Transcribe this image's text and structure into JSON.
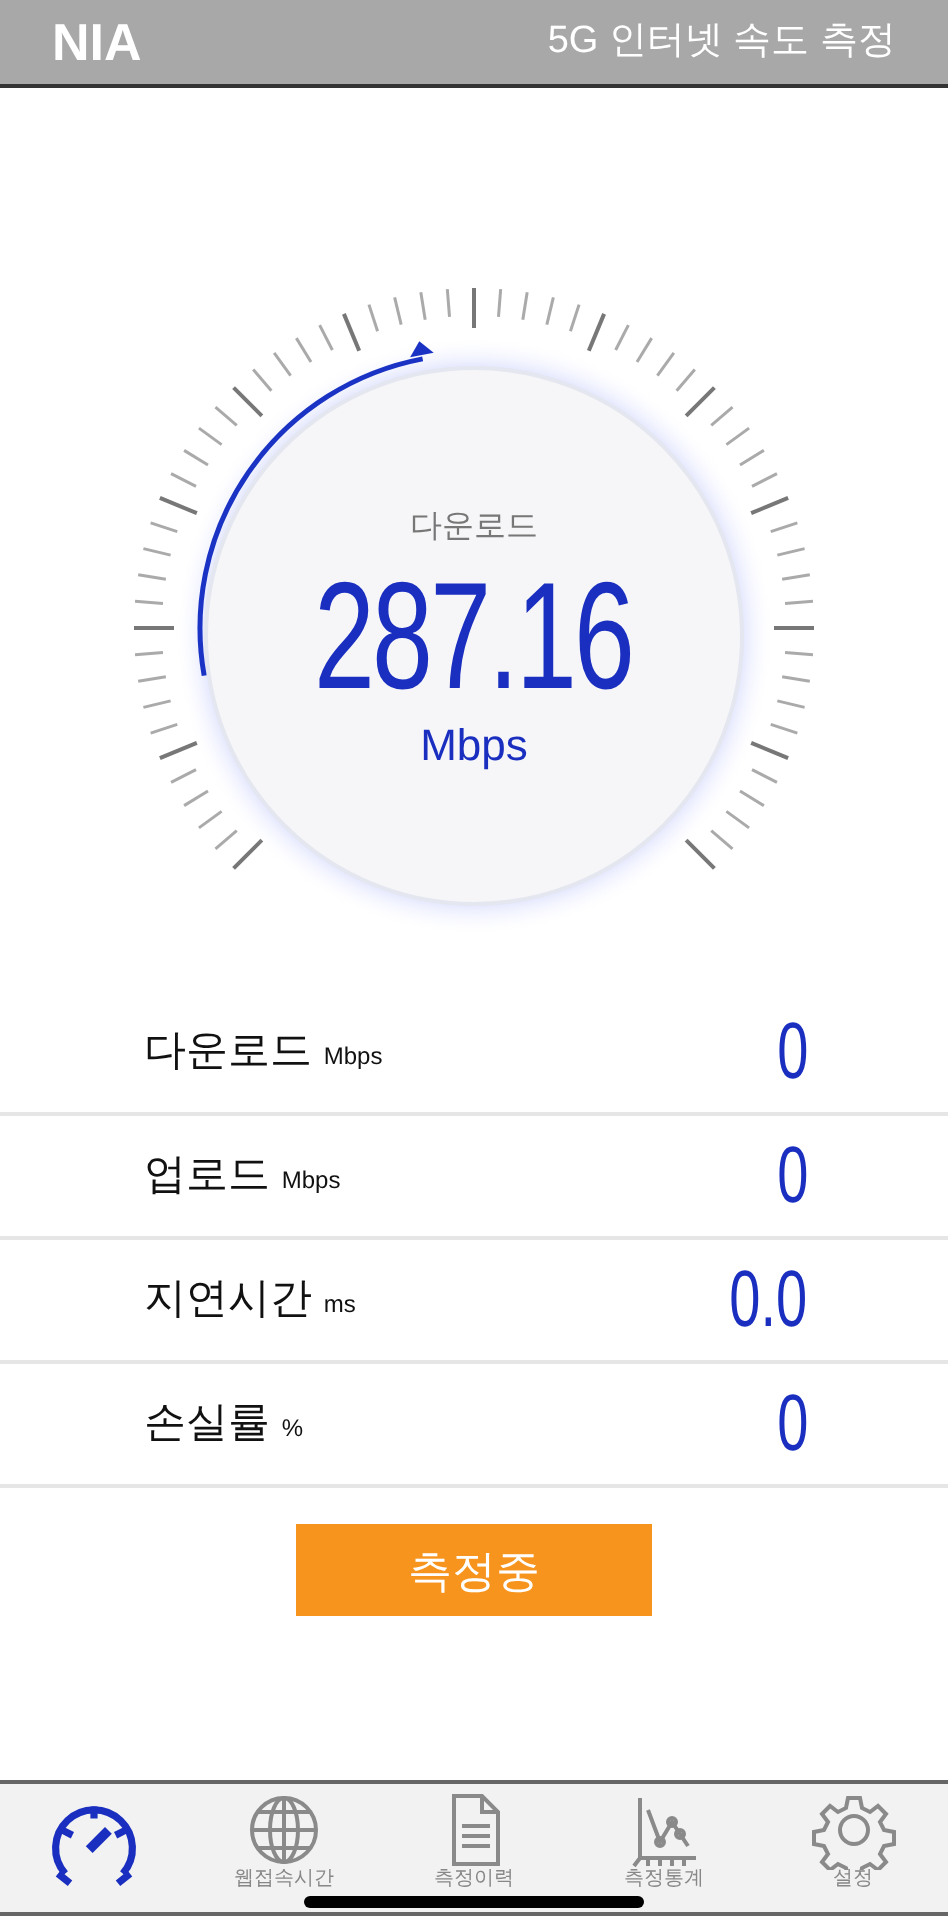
{
  "header": {
    "logo": "NIA",
    "title": "5G 인터넷 속도 측정"
  },
  "gauge": {
    "label": "다운로드",
    "value": "287.16",
    "unit": "Mbps",
    "level": 0.46
  },
  "results": [
    {
      "name": "다운로드",
      "unit": "Mbps",
      "value": "0"
    },
    {
      "name": "업로드",
      "unit": "Mbps",
      "value": "0"
    },
    {
      "name": "지연시간",
      "unit": "ms",
      "value": "0.0"
    },
    {
      "name": "손실률",
      "unit": "%",
      "value": "0"
    }
  ],
  "action_button": "측정중",
  "nav": [
    {
      "kind": "speed",
      "selected": true
    },
    {
      "kind": "web",
      "label": "웹접속시간",
      "selected": false
    },
    {
      "kind": "history",
      "label": "측정이력",
      "selected": false
    },
    {
      "kind": "stats",
      "label": "측정통계",
      "selected": false
    },
    {
      "kind": "settings",
      "label": "설정",
      "selected": false
    }
  ]
}
